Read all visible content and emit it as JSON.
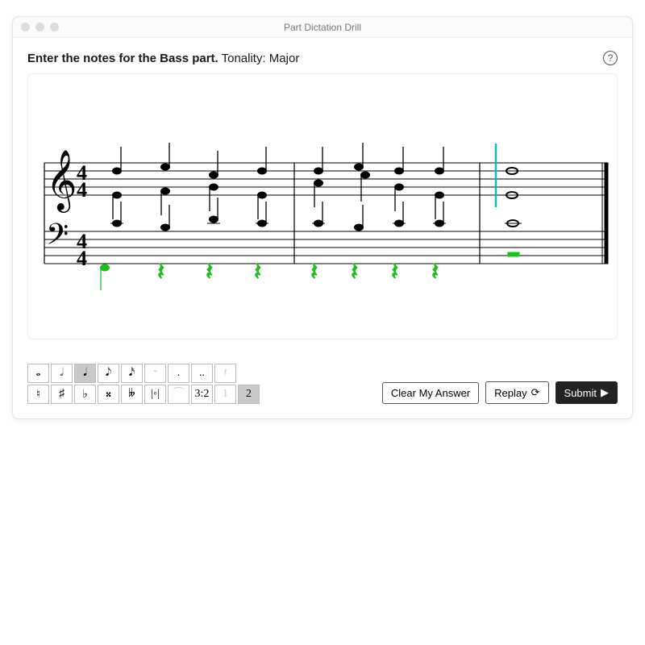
{
  "window": {
    "title": "Part Dictation Drill"
  },
  "instruction": {
    "bold": "Enter the notes for the Bass part.",
    "normal": " Tonality: Major"
  },
  "help": {
    "glyph": "?"
  },
  "score": {
    "time_signature": "4/4",
    "measures": 3,
    "cursor": {
      "measure": 3,
      "beat": 1
    },
    "treble": {
      "m1": [
        {
          "beat": 1,
          "top": "C5",
          "bot": "E4",
          "stemsplit": true
        },
        {
          "beat": 2,
          "top": "D5",
          "bot": "F4",
          "stemsplit": true
        },
        {
          "beat": 3,
          "top": "B4",
          "bot": "G4",
          "stemsplit": true
        },
        {
          "beat": 4,
          "top": "C5",
          "bot": "E4",
          "stemsplit": true
        }
      ],
      "m2": [
        {
          "beat": 1,
          "top": "C5",
          "bot": "A4",
          "stemsplit": true
        },
        {
          "beat": 2,
          "top": "D5",
          "bot": "B4",
          "stemsplit": true
        },
        {
          "beat": 3,
          "top": "C5",
          "bot": "G4",
          "stemsplit": true
        },
        {
          "beat": 4,
          "top": "C5",
          "bot": "E4",
          "stemsplit": true
        }
      ],
      "m3": [
        {
          "beat": 1,
          "whole_chord": [
            "C5",
            "E4"
          ]
        }
      ]
    },
    "bass": {
      "tenor": {
        "m1": [
          {
            "beat": 1,
            "n": "C4"
          },
          {
            "beat": 2,
            "n": "B3"
          },
          {
            "beat": 3,
            "n": "D4"
          },
          {
            "beat": 4,
            "n": "C4"
          }
        ],
        "m2": [
          {
            "beat": 1,
            "n": "C4"
          },
          {
            "beat": 2,
            "n": "B3"
          },
          {
            "beat": 3,
            "n": "C4"
          },
          {
            "beat": 4,
            "n": "C4"
          }
        ],
        "m3": [
          {
            "beat": 1,
            "whole": "C4"
          }
        ]
      },
      "entry": {
        "m1": [
          {
            "beat": 1,
            "n": "G2",
            "green": true
          },
          {
            "beat": 2,
            "rest": "q",
            "green": true
          },
          {
            "beat": 3,
            "rest": "q",
            "green": true
          },
          {
            "beat": 4,
            "rest": "q",
            "green": true
          }
        ],
        "m2": [
          {
            "beat": 1,
            "rest": "q",
            "green": true
          },
          {
            "beat": 2,
            "rest": "q",
            "green": true
          },
          {
            "beat": 3,
            "rest": "q",
            "green": true
          },
          {
            "beat": 4,
            "rest": "q",
            "green": true
          }
        ],
        "m3": [
          {
            "beat": 1,
            "rest": "half",
            "green": true
          }
        ]
      }
    }
  },
  "palette": {
    "row1": [
      {
        "id": "whole",
        "glyph": "𝅝",
        "enabled": true
      },
      {
        "id": "half",
        "glyph": "𝅗𝅥",
        "enabled": true
      },
      {
        "id": "quarter",
        "glyph": "𝅘𝅥",
        "enabled": true,
        "selected": true
      },
      {
        "id": "eighth",
        "glyph": "𝅘𝅥𝅮",
        "enabled": true
      },
      {
        "id": "sixteenth",
        "glyph": "𝅘𝅥𝅯",
        "enabled": true
      },
      {
        "id": "half-rest",
        "glyph": "𝄼",
        "enabled": false
      },
      {
        "id": "dot",
        "glyph": ".",
        "enabled": true
      },
      {
        "id": "double-dot",
        "glyph": "..",
        "enabled": true
      },
      {
        "id": "rest-group",
        "glyph": "𝄽",
        "enabled": false
      }
    ],
    "row2": [
      {
        "id": "natural",
        "glyph": "♮",
        "enabled": true
      },
      {
        "id": "sharp",
        "glyph": "♯",
        "enabled": true
      },
      {
        "id": "flat",
        "glyph": "♭",
        "enabled": true
      },
      {
        "id": "double-sharp",
        "glyph": "𝄪",
        "enabled": true
      },
      {
        "id": "double-flat",
        "glyph": "𝄫",
        "enabled": true
      },
      {
        "id": "enharmonic",
        "glyph": "|◦|",
        "enabled": true
      },
      {
        "id": "tie",
        "glyph": "⁀",
        "enabled": false
      },
      {
        "id": "tuplet",
        "glyph": "3:2",
        "enabled": true
      },
      {
        "id": "voice1",
        "glyph": "1",
        "enabled": false
      },
      {
        "id": "voice2",
        "glyph": "2",
        "enabled": true,
        "selected": true
      }
    ]
  },
  "actions": {
    "clear": "Clear My Answer",
    "replay": "Replay",
    "submit": "Submit"
  }
}
